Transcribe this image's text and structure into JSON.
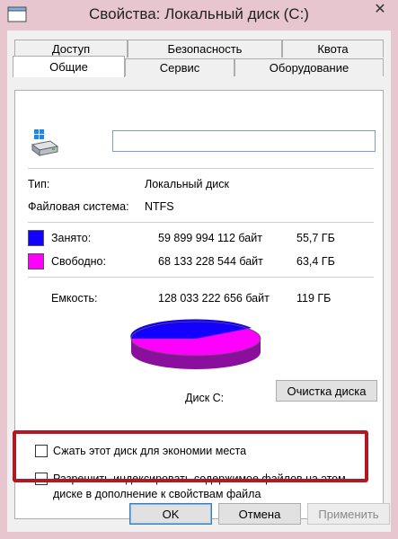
{
  "window": {
    "title": "Свойства: Локальный диск (C:)",
    "close_glyph": "✕"
  },
  "tabs": {
    "row1": [
      "Доступ",
      "Безопасность",
      "Квота"
    ],
    "row2": [
      "Общие",
      "Сервис",
      "Оборудование"
    ],
    "active": "Общие"
  },
  "general": {
    "name_value": "",
    "type_label": "Тип:",
    "type_value": "Локальный диск",
    "fs_label": "Файловая система:",
    "fs_value": "NTFS",
    "used": {
      "label": "Занято:",
      "bytes": "59 899 994 112 байт",
      "size": "55,7 ГБ",
      "color": "#1400ff"
    },
    "free": {
      "label": "Свободно:",
      "bytes": "68 133 228 544 байт",
      "size": "63,4 ГБ",
      "color": "#ff00ff"
    },
    "capacity": {
      "label": "Емкость:",
      "bytes": "128 033 222 656 байт",
      "size": "119 ГБ"
    },
    "disk_caption": "Диск C:",
    "cleanup_button": "Очистка диска",
    "compress_label": "Сжать этот диск для экономии места",
    "index_label_line1": "Разрешить индексировать содержимое файлов на этом",
    "index_label_line2": "диске в дополнение к свойствам файла",
    "highlight_color": "#b01822"
  },
  "buttons": {
    "ok": "OK",
    "cancel": "Отмена",
    "apply": "Применить"
  },
  "icons": [
    "app-window-icon",
    "close-icon",
    "hard-drive-icon"
  ]
}
